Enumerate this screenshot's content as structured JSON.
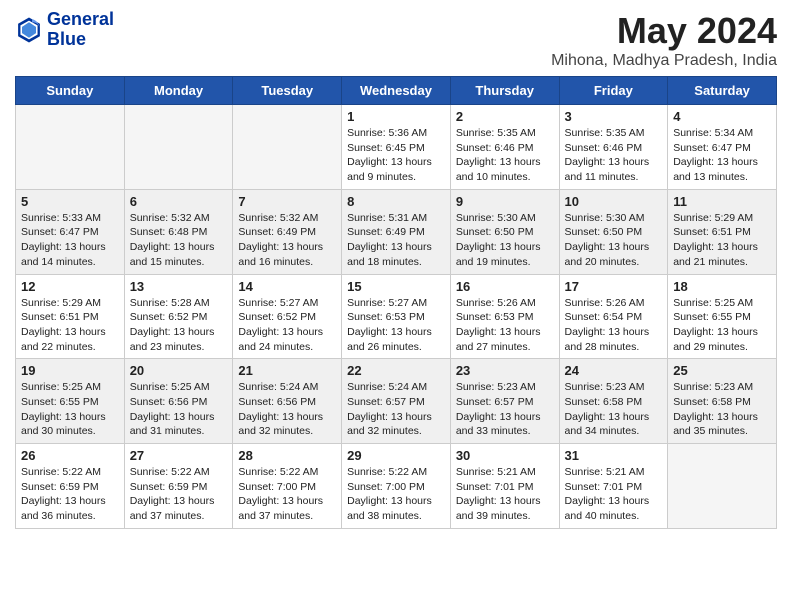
{
  "header": {
    "logo_line1": "General",
    "logo_line2": "Blue",
    "main_title": "May 2024",
    "subtitle": "Mihona, Madhya Pradesh, India"
  },
  "days_of_week": [
    "Sunday",
    "Monday",
    "Tuesday",
    "Wednesday",
    "Thursday",
    "Friday",
    "Saturday"
  ],
  "weeks": [
    [
      {
        "day": "",
        "info": ""
      },
      {
        "day": "",
        "info": ""
      },
      {
        "day": "",
        "info": ""
      },
      {
        "day": "1",
        "info": "Sunrise: 5:36 AM\nSunset: 6:45 PM\nDaylight: 13 hours\nand 9 minutes."
      },
      {
        "day": "2",
        "info": "Sunrise: 5:35 AM\nSunset: 6:46 PM\nDaylight: 13 hours\nand 10 minutes."
      },
      {
        "day": "3",
        "info": "Sunrise: 5:35 AM\nSunset: 6:46 PM\nDaylight: 13 hours\nand 11 minutes."
      },
      {
        "day": "4",
        "info": "Sunrise: 5:34 AM\nSunset: 6:47 PM\nDaylight: 13 hours\nand 13 minutes."
      }
    ],
    [
      {
        "day": "5",
        "info": "Sunrise: 5:33 AM\nSunset: 6:47 PM\nDaylight: 13 hours\nand 14 minutes."
      },
      {
        "day": "6",
        "info": "Sunrise: 5:32 AM\nSunset: 6:48 PM\nDaylight: 13 hours\nand 15 minutes."
      },
      {
        "day": "7",
        "info": "Sunrise: 5:32 AM\nSunset: 6:49 PM\nDaylight: 13 hours\nand 16 minutes."
      },
      {
        "day": "8",
        "info": "Sunrise: 5:31 AM\nSunset: 6:49 PM\nDaylight: 13 hours\nand 18 minutes."
      },
      {
        "day": "9",
        "info": "Sunrise: 5:30 AM\nSunset: 6:50 PM\nDaylight: 13 hours\nand 19 minutes."
      },
      {
        "day": "10",
        "info": "Sunrise: 5:30 AM\nSunset: 6:50 PM\nDaylight: 13 hours\nand 20 minutes."
      },
      {
        "day": "11",
        "info": "Sunrise: 5:29 AM\nSunset: 6:51 PM\nDaylight: 13 hours\nand 21 minutes."
      }
    ],
    [
      {
        "day": "12",
        "info": "Sunrise: 5:29 AM\nSunset: 6:51 PM\nDaylight: 13 hours\nand 22 minutes."
      },
      {
        "day": "13",
        "info": "Sunrise: 5:28 AM\nSunset: 6:52 PM\nDaylight: 13 hours\nand 23 minutes."
      },
      {
        "day": "14",
        "info": "Sunrise: 5:27 AM\nSunset: 6:52 PM\nDaylight: 13 hours\nand 24 minutes."
      },
      {
        "day": "15",
        "info": "Sunrise: 5:27 AM\nSunset: 6:53 PM\nDaylight: 13 hours\nand 26 minutes."
      },
      {
        "day": "16",
        "info": "Sunrise: 5:26 AM\nSunset: 6:53 PM\nDaylight: 13 hours\nand 27 minutes."
      },
      {
        "day": "17",
        "info": "Sunrise: 5:26 AM\nSunset: 6:54 PM\nDaylight: 13 hours\nand 28 minutes."
      },
      {
        "day": "18",
        "info": "Sunrise: 5:25 AM\nSunset: 6:55 PM\nDaylight: 13 hours\nand 29 minutes."
      }
    ],
    [
      {
        "day": "19",
        "info": "Sunrise: 5:25 AM\nSunset: 6:55 PM\nDaylight: 13 hours\nand 30 minutes."
      },
      {
        "day": "20",
        "info": "Sunrise: 5:25 AM\nSunset: 6:56 PM\nDaylight: 13 hours\nand 31 minutes."
      },
      {
        "day": "21",
        "info": "Sunrise: 5:24 AM\nSunset: 6:56 PM\nDaylight: 13 hours\nand 32 minutes."
      },
      {
        "day": "22",
        "info": "Sunrise: 5:24 AM\nSunset: 6:57 PM\nDaylight: 13 hours\nand 32 minutes."
      },
      {
        "day": "23",
        "info": "Sunrise: 5:23 AM\nSunset: 6:57 PM\nDaylight: 13 hours\nand 33 minutes."
      },
      {
        "day": "24",
        "info": "Sunrise: 5:23 AM\nSunset: 6:58 PM\nDaylight: 13 hours\nand 34 minutes."
      },
      {
        "day": "25",
        "info": "Sunrise: 5:23 AM\nSunset: 6:58 PM\nDaylight: 13 hours\nand 35 minutes."
      }
    ],
    [
      {
        "day": "26",
        "info": "Sunrise: 5:22 AM\nSunset: 6:59 PM\nDaylight: 13 hours\nand 36 minutes."
      },
      {
        "day": "27",
        "info": "Sunrise: 5:22 AM\nSunset: 6:59 PM\nDaylight: 13 hours\nand 37 minutes."
      },
      {
        "day": "28",
        "info": "Sunrise: 5:22 AM\nSunset: 7:00 PM\nDaylight: 13 hours\nand 37 minutes."
      },
      {
        "day": "29",
        "info": "Sunrise: 5:22 AM\nSunset: 7:00 PM\nDaylight: 13 hours\nand 38 minutes."
      },
      {
        "day": "30",
        "info": "Sunrise: 5:21 AM\nSunset: 7:01 PM\nDaylight: 13 hours\nand 39 minutes."
      },
      {
        "day": "31",
        "info": "Sunrise: 5:21 AM\nSunset: 7:01 PM\nDaylight: 13 hours\nand 40 minutes."
      },
      {
        "day": "",
        "info": ""
      }
    ]
  ]
}
